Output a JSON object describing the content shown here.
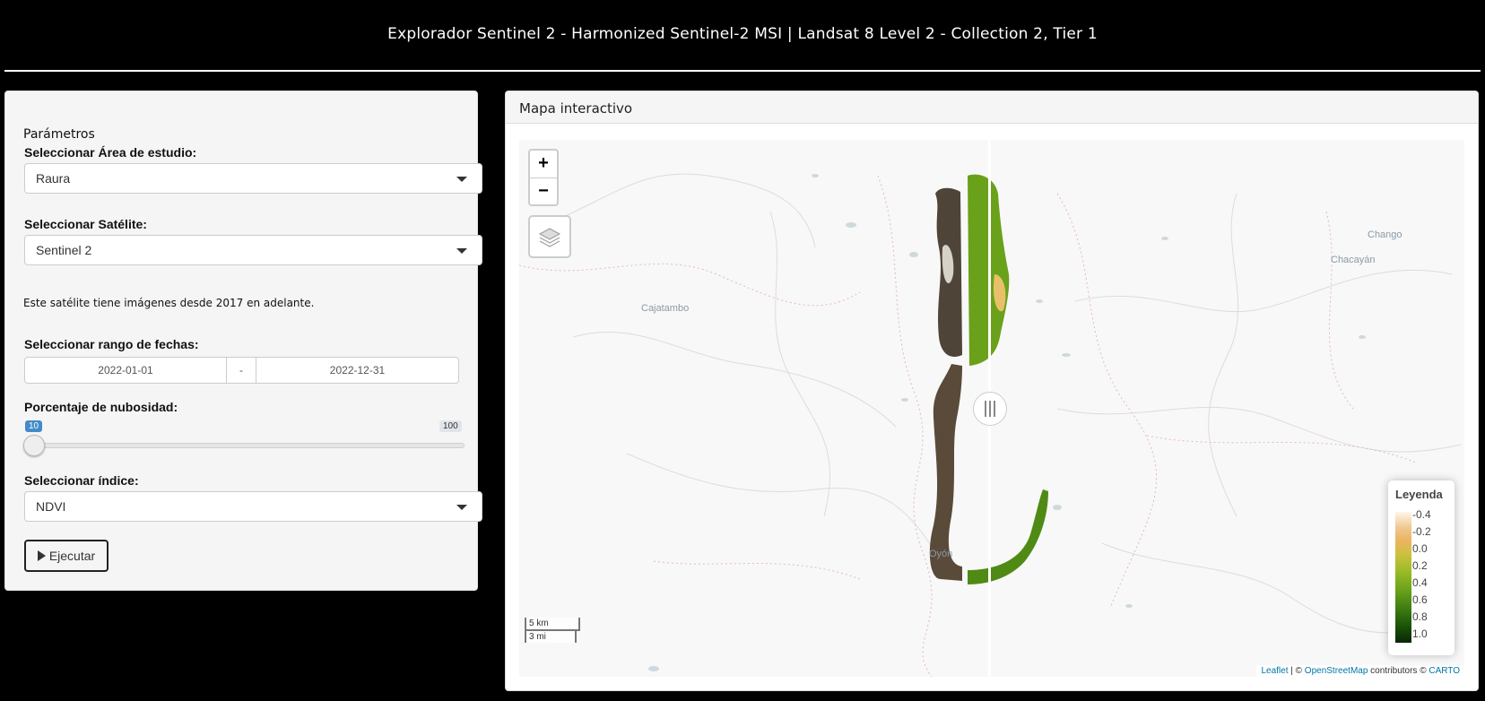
{
  "header": {
    "title": "Explorador Sentinel 2 - Harmonized Sentinel-2 MSI | Landsat 8 Level 2 - Collection 2, Tier 1"
  },
  "params": {
    "title": "Parámetros",
    "area_label": "Seleccionar Área de estudio:",
    "area_value": "Raura",
    "satellite_label": "Seleccionar Satélite:",
    "satellite_value": "Sentinel 2",
    "info": "Este satélite tiene imágenes desde 2017 en adelante.",
    "date_label": "Seleccionar rango de fechas:",
    "date_start": "2022-01-01",
    "date_sep": "-",
    "date_end": "2022-12-31",
    "cloud_label": "Porcentaje de nubosidad:",
    "cloud_value": "10",
    "cloud_max": "100",
    "index_label": "Seleccionar índice:",
    "index_value": "NDVI",
    "run_label": "Ejecutar"
  },
  "map_panel": {
    "title": "Mapa interactivo",
    "zoom_in": "+",
    "zoom_out": "−",
    "places": {
      "cajatambo": "Cajatambo",
      "chango": "Chango",
      "chacayan": "Chacayán",
      "oyon": "Oyón"
    },
    "legend": {
      "title": "Leyenda",
      "ticks": [
        "-0.4",
        "-0.2",
        "0.0",
        "0.2",
        "0.4",
        "0.6",
        "0.8",
        "1.0"
      ]
    },
    "scale": {
      "km": "5 km",
      "mi": "3 mi"
    },
    "attribution": {
      "leaflet": "Leaflet",
      "sep1": " | © ",
      "osm": "OpenStreetMap",
      "mid": " contributors © ",
      "carto": "CARTO"
    }
  },
  "colors": {
    "primary": "#428bca",
    "ndvi_green": "#6aa11a",
    "rgb_brown": "#5a4a3a"
  },
  "icons": {
    "layers": "layers-icon",
    "play": "play-icon",
    "caret": "caret-down-icon"
  }
}
